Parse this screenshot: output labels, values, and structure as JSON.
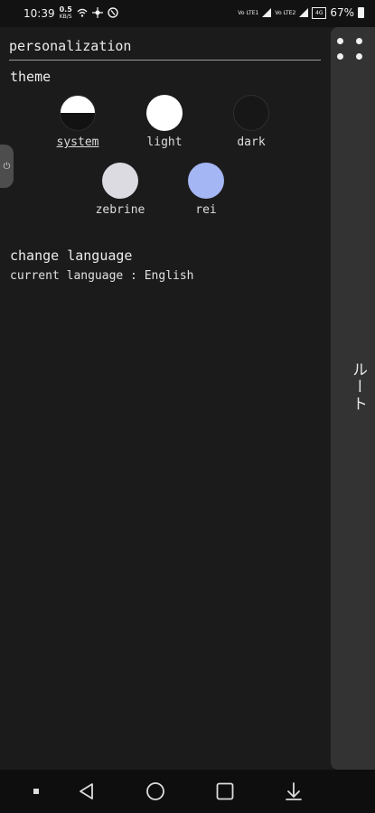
{
  "status_bar": {
    "time": "10:39",
    "net_speed_value": "0.5",
    "net_speed_unit": "KB/S",
    "sim1_label": "Vo LTE1",
    "sim2_label": "Vo LTE2",
    "network_type": "4G",
    "battery_percent": "67%"
  },
  "panel": {
    "title": "personalization",
    "theme_heading": "theme",
    "themes": [
      {
        "label": "system",
        "selected": true
      },
      {
        "label": "light",
        "selected": false
      },
      {
        "label": "dark",
        "selected": false
      },
      {
        "label": "zebrine",
        "selected": false
      },
      {
        "label": "rei",
        "selected": false
      }
    ],
    "language": {
      "heading": "change language",
      "current_label": "current language : ",
      "current_value": "English"
    }
  },
  "drawer": {
    "vertical_text": "ルート"
  },
  "colors": {
    "background": "#1b1b1b",
    "drawer": "#333333",
    "rei": "#a5b6f5",
    "zebrine": "#dcdbe2"
  },
  "icons": [
    "wifi-icon",
    "network-icon",
    "sync-icon",
    "signal-icon",
    "battery-icon",
    "grid-dots-icon",
    "power-icon",
    "back-icon",
    "home-icon",
    "recents-icon",
    "download-icon"
  ]
}
